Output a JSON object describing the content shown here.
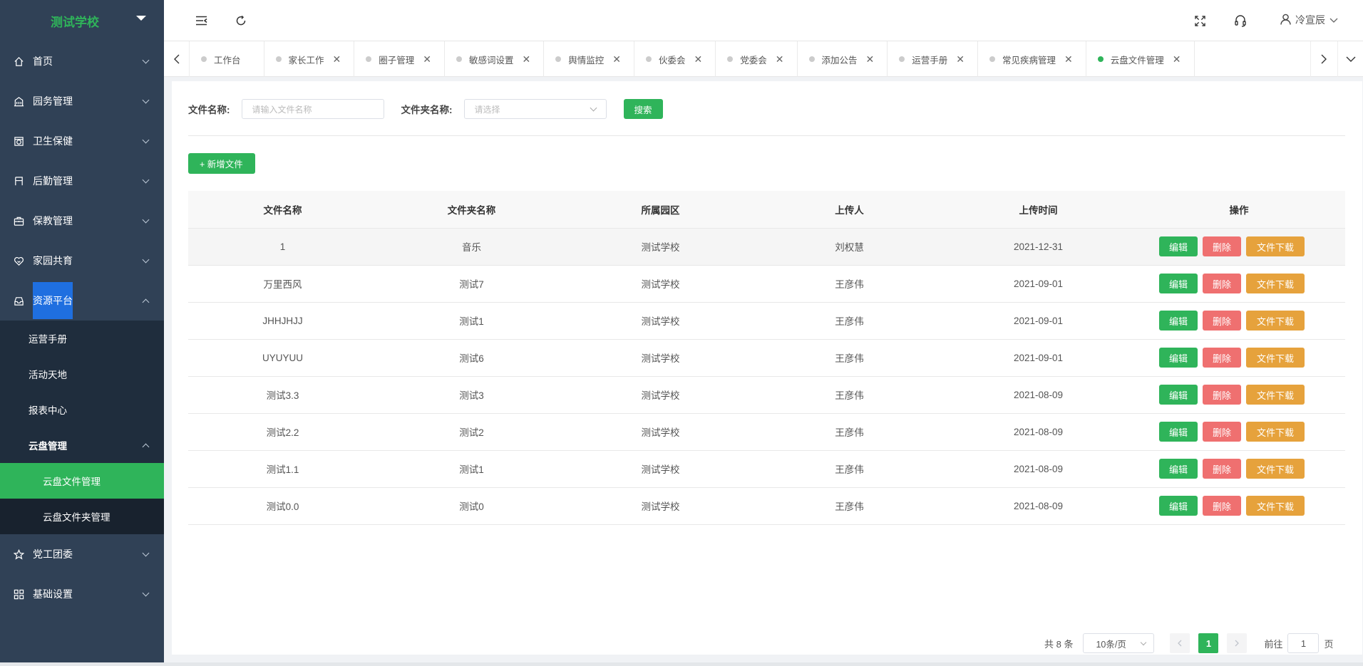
{
  "sidebar": {
    "logo": "测试学校",
    "menu_before": [
      {
        "label": "首页",
        "icon": "home-icon"
      },
      {
        "label": "园务管理",
        "icon": "building-icon"
      },
      {
        "label": "卫生保健",
        "icon": "health-icon"
      },
      {
        "label": "后勤管理",
        "icon": "logistics-icon"
      },
      {
        "label": "保教管理",
        "icon": "briefcase-icon"
      },
      {
        "label": "家园共育",
        "icon": "heart-icon"
      }
    ],
    "resource": {
      "label": "资源平台",
      "icon": "inbox-icon"
    },
    "resource_sub": [
      "运营手册",
      "活动天地",
      "报表中心"
    ],
    "cloud_group": "云盘管理",
    "cloud_sub": [
      "云盘文件管理",
      "云盘文件夹管理"
    ],
    "menu_after": [
      {
        "label": "党工团委",
        "icon": "star-icon"
      },
      {
        "label": "基础设置",
        "icon": "grid-icon"
      }
    ]
  },
  "header": {
    "user_name": "冷宣辰",
    "icons": [
      "menu-toggle-icon",
      "refresh-icon",
      "fullscreen-icon",
      "headset-icon",
      "user-icon"
    ]
  },
  "tabs": [
    {
      "label": "工作台",
      "closable": false,
      "active": false
    },
    {
      "label": "家长工作",
      "closable": true,
      "active": false
    },
    {
      "label": "圈子管理",
      "closable": true,
      "active": false
    },
    {
      "label": "敏感词设置",
      "closable": true,
      "active": false
    },
    {
      "label": "舆情监控",
      "closable": true,
      "active": false
    },
    {
      "label": "伙委会",
      "closable": true,
      "active": false
    },
    {
      "label": "党委会",
      "closable": true,
      "active": false
    },
    {
      "label": "添加公告",
      "closable": true,
      "active": false
    },
    {
      "label": "运营手册",
      "closable": true,
      "active": false
    },
    {
      "label": "常见疾病管理",
      "closable": true,
      "active": false
    },
    {
      "label": "云盘文件管理",
      "closable": true,
      "active": true
    }
  ],
  "filter": {
    "file_name_label": "文件名称:",
    "file_name_placeholder": "请输入文件名称",
    "folder_label": "文件夹名称:",
    "folder_placeholder": "请选择",
    "search_button": "搜索"
  },
  "add_button": "+ 新增文件",
  "table": {
    "headers": [
      "文件名称",
      "文件夹名称",
      "所属园区",
      "上传人",
      "上传时间",
      "操作"
    ],
    "rows": [
      [
        "1",
        "音乐",
        "测试学校",
        "刘权慧",
        "2021-12-31"
      ],
      [
        "万里西风",
        "测试7",
        "测试学校",
        "王彦伟",
        "2021-09-01"
      ],
      [
        "JHHJHJJ",
        "测试1",
        "测试学校",
        "王彦伟",
        "2021-09-01"
      ],
      [
        "UYUYUU",
        "测试6",
        "测试学校",
        "王彦伟",
        "2021-09-01"
      ],
      [
        "测试3.3",
        "测试3",
        "测试学校",
        "王彦伟",
        "2021-08-09"
      ],
      [
        "测试2.2",
        "测试2",
        "测试学校",
        "王彦伟",
        "2021-08-09"
      ],
      [
        "测试1.1",
        "测试1",
        "测试学校",
        "王彦伟",
        "2021-08-09"
      ],
      [
        "测试0.0",
        "测试0",
        "测试学校",
        "王彦伟",
        "2021-08-09"
      ]
    ],
    "actions": {
      "edit": "编辑",
      "delete": "删除",
      "download": "文件下载"
    }
  },
  "pagination": {
    "total_text": "共 8 条",
    "page_size": "10条/页",
    "current_page": "1",
    "goto_label": "前往",
    "goto_value": "1",
    "page_suffix": "页"
  },
  "colors": {
    "accent": "#2fb45a",
    "danger": "#ef7070",
    "warning": "#e6a23c",
    "sidebar": "#304156"
  }
}
